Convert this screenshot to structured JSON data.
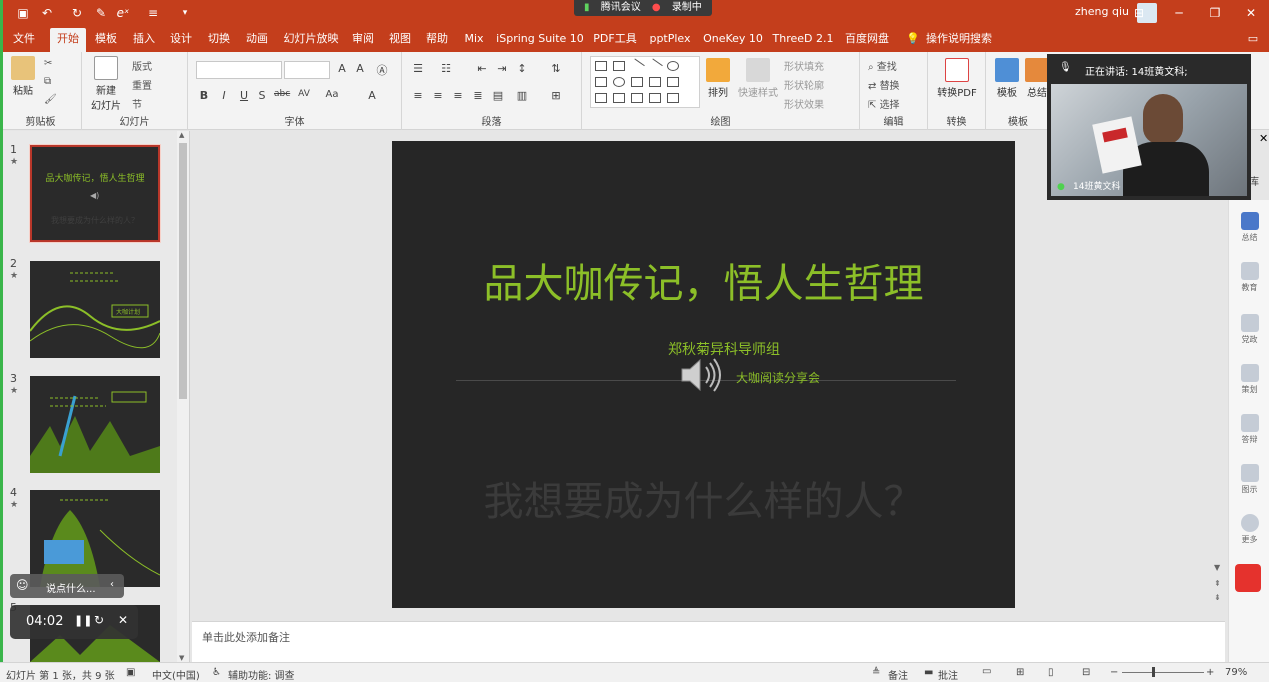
{
  "titlebar": {
    "meeting_app": "腾讯会议",
    "recording": "录制中",
    "user_name": "zheng qiu"
  },
  "tabs": [
    "文件",
    "开始",
    "模板",
    "插入",
    "设计",
    "切换",
    "动画",
    "幻灯片放映",
    "审阅",
    "视图",
    "帮助",
    "Mix",
    "iSpring Suite 10",
    "PDF工具",
    "pptPlex",
    "OneKey 10",
    "ThreeD 2.1",
    "百度网盘",
    "操作说明搜索"
  ],
  "active_tab": "开始",
  "ribbon": {
    "clipboard": {
      "paste": "粘贴",
      "label": "剪贴板"
    },
    "slides": {
      "new_slide": "新建\n幻灯片",
      "layout": "版式",
      "reset": "重置",
      "section": "节",
      "label": "幻灯片"
    },
    "font": {
      "label": "字体"
    },
    "paragraph": {
      "label": "段落"
    },
    "drawing": {
      "arrange": "排列",
      "quick_styles": "快速样式",
      "fill": "形状填充",
      "outline": "形状轮廓",
      "effects": "形状效果",
      "label": "绘图"
    },
    "editing": {
      "find": "查找",
      "replace": "替换",
      "select": "选择",
      "label": "编辑"
    },
    "convert": {
      "to_pdf": "转换PDF",
      "label": "转换"
    },
    "templates": {
      "template": "模板",
      "summary": "总结",
      "label": "模板"
    }
  },
  "slides": [
    {
      "num": "1",
      "title": "品大咖传记，悟人生哲理",
      "subtitle": "我想要成为什么样的人？"
    },
    {
      "num": "2",
      "tag": "大咖计划"
    },
    {
      "num": "3"
    },
    {
      "num": "4"
    },
    {
      "num": "5"
    }
  ],
  "current_slide": {
    "title": "品大咖传记，悟人生哲理",
    "group": "郑秋菊异科导师组",
    "event": "大咖阅读分享会",
    "question": "我想要成为什么样的人？"
  },
  "notes_placeholder": "单击此处添加备注",
  "video": {
    "speaking": "正在讲话: 14班黄文科;",
    "participant": "14班黄文科",
    "side_text": "库"
  },
  "right_sidebar": [
    "总结",
    "教育",
    "党政",
    "策划",
    "答辩",
    "图示",
    "更多"
  ],
  "chat_placeholder": "说点什么...",
  "recording_time": "04:02",
  "statusbar": {
    "slide_info": "幻灯片 第 1 张，共 9 张",
    "language": "中文(中国)",
    "accessibility": "辅助功能: 调查",
    "notes": "备注",
    "comments": "批注",
    "zoom": "79%"
  },
  "colors": {
    "accent": "#c43e1c",
    "slide_green": "#8cbf28",
    "slide_bg": "#262626"
  }
}
